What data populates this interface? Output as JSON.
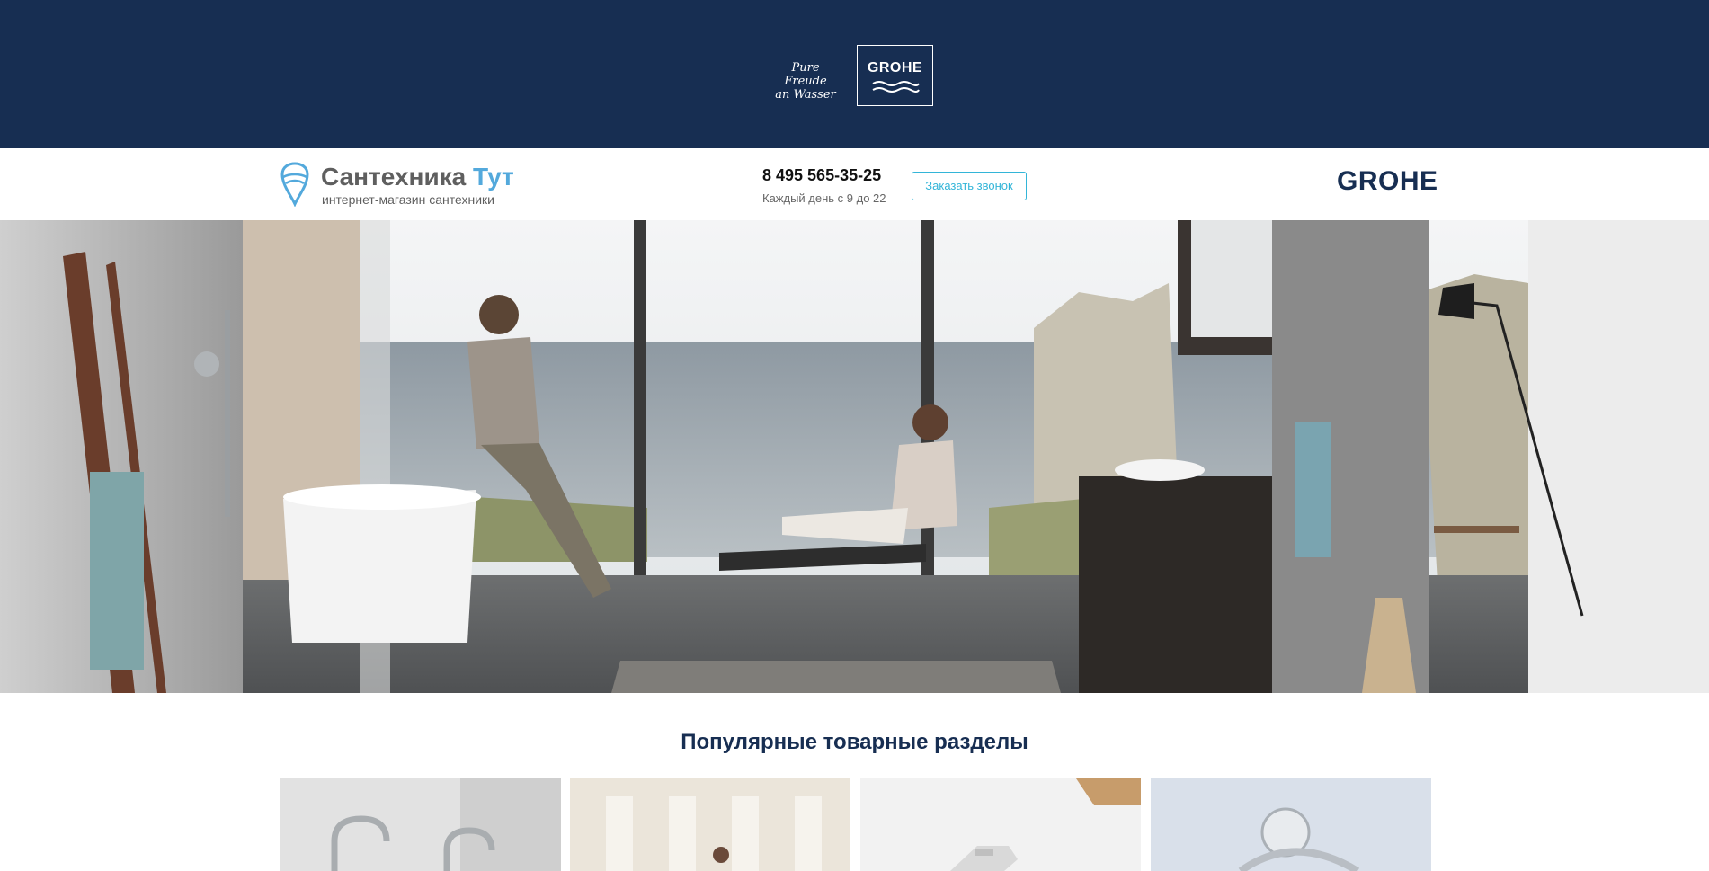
{
  "banner": {
    "tagline_line1": "Pure Freude",
    "tagline_line2": "an Wasser",
    "brand_box_text": "GROHE"
  },
  "header": {
    "logo_name_part1": "Сантехника",
    "logo_name_part2": "Тут",
    "logo_subtitle": "интернет-магазин сантехники",
    "phone": "8 495 565-35-25",
    "hours": "Каждый день с 9 до 22",
    "callback_label": "Заказать звонок",
    "brand": "GROHE"
  },
  "section": {
    "title": "Популярные товарные разделы"
  },
  "colors": {
    "banner_bg": "#172e52",
    "accent": "#33b5d8",
    "logo_blue": "#53a9dc"
  }
}
